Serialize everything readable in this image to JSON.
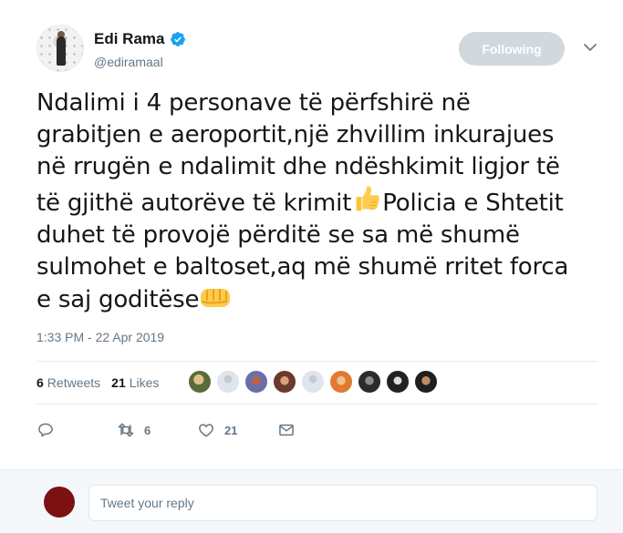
{
  "user": {
    "name": "Edi Rama",
    "handle": "@ediramaal",
    "follow_label": "Following"
  },
  "tweet": {
    "lines": [
      "Ndalimi i 4 personave të përfshirë në",
      "grabitjen e aeroportit,një zhvillim inkurajues",
      "në rrugën e ndalimit dhe ndëshkimit ligjor të",
      "të gjithë autorëve të krimit",
      "Policia e Shtetit",
      "duhet të provojë përditë se sa më shumë",
      "sulmohet e baltoset,aq më shumë rritet forca",
      "e saj goditëse"
    ],
    "timestamp": "1:33 PM - 22 Apr 2019"
  },
  "stats": {
    "retweets_count": "6",
    "retweets_label": "Retweets",
    "likes_count": "21",
    "likes_label": "Likes"
  },
  "actions": {
    "retweet_count": "6",
    "like_count": "21"
  },
  "reply": {
    "placeholder": "Tweet your reply"
  },
  "colors": {
    "verified": "#1da1f2",
    "secondary_text": "#657786",
    "follow_button": "#cfd9de"
  }
}
